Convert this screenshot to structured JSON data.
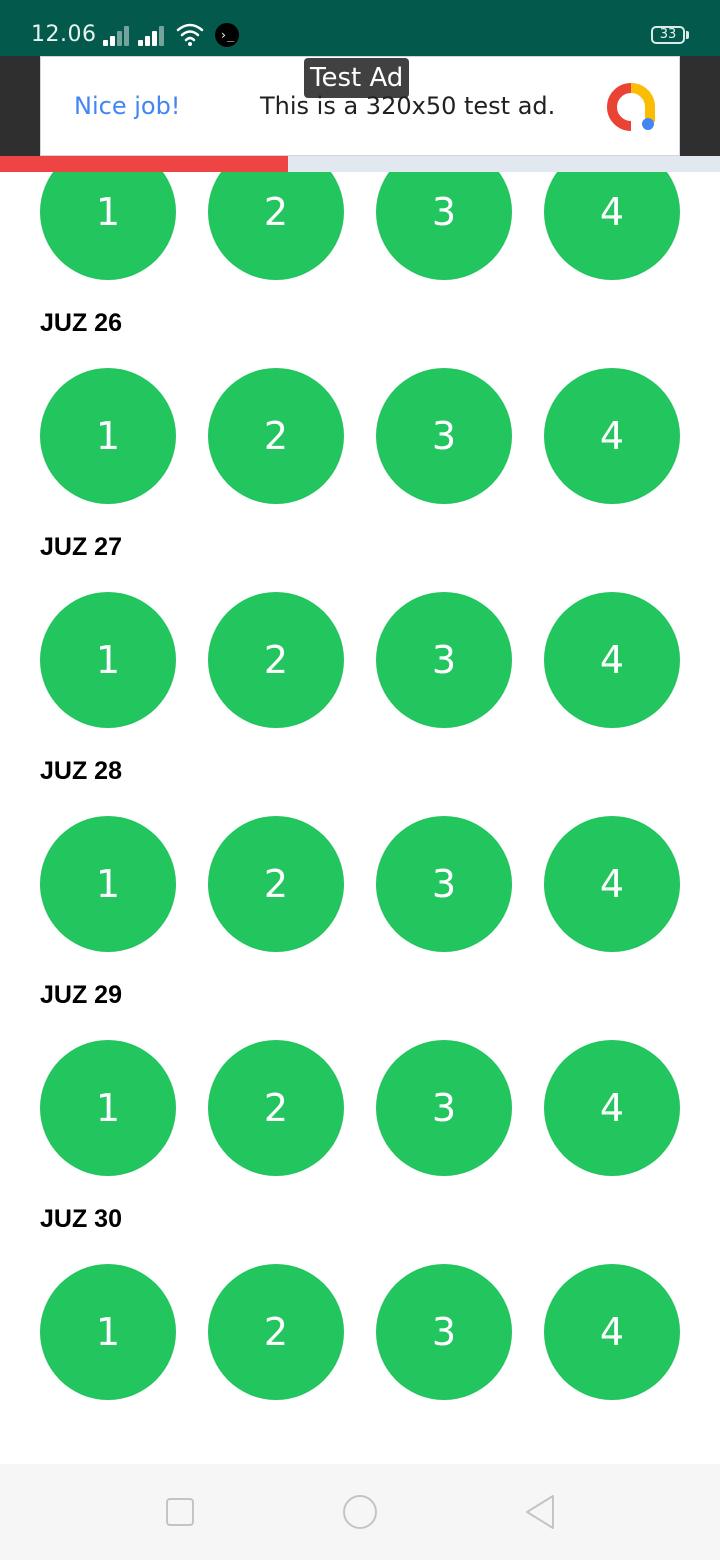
{
  "status_bar": {
    "time": "12.06",
    "battery": "33",
    "icons": [
      "signal-icon",
      "signal-icon",
      "wifi-icon",
      "terminal-icon",
      "battery-icon"
    ]
  },
  "ad": {
    "label": "Test Ad",
    "headline": "Nice job!",
    "text": "This is a 320x50 test ad.",
    "logo_icon": "admob-logo-icon"
  },
  "progress": {
    "value": 0.4
  },
  "colors": {
    "status_bar": "#035a4c",
    "circle": "#22c55e",
    "progress": "#ef4444"
  },
  "sections": [
    {
      "title": "",
      "items": [
        "1",
        "2",
        "3",
        "4"
      ]
    },
    {
      "title": "JUZ 26",
      "items": [
        "1",
        "2",
        "3",
        "4"
      ]
    },
    {
      "title": "JUZ 27",
      "items": [
        "1",
        "2",
        "3",
        "4"
      ]
    },
    {
      "title": "JUZ 28",
      "items": [
        "1",
        "2",
        "3",
        "4"
      ]
    },
    {
      "title": "JUZ 29",
      "items": [
        "1",
        "2",
        "3",
        "4"
      ]
    },
    {
      "title": "JUZ 30",
      "items": [
        "1",
        "2",
        "3",
        "4"
      ]
    }
  ],
  "nav": {
    "buttons": [
      "recents-icon",
      "home-icon",
      "back-icon"
    ]
  }
}
